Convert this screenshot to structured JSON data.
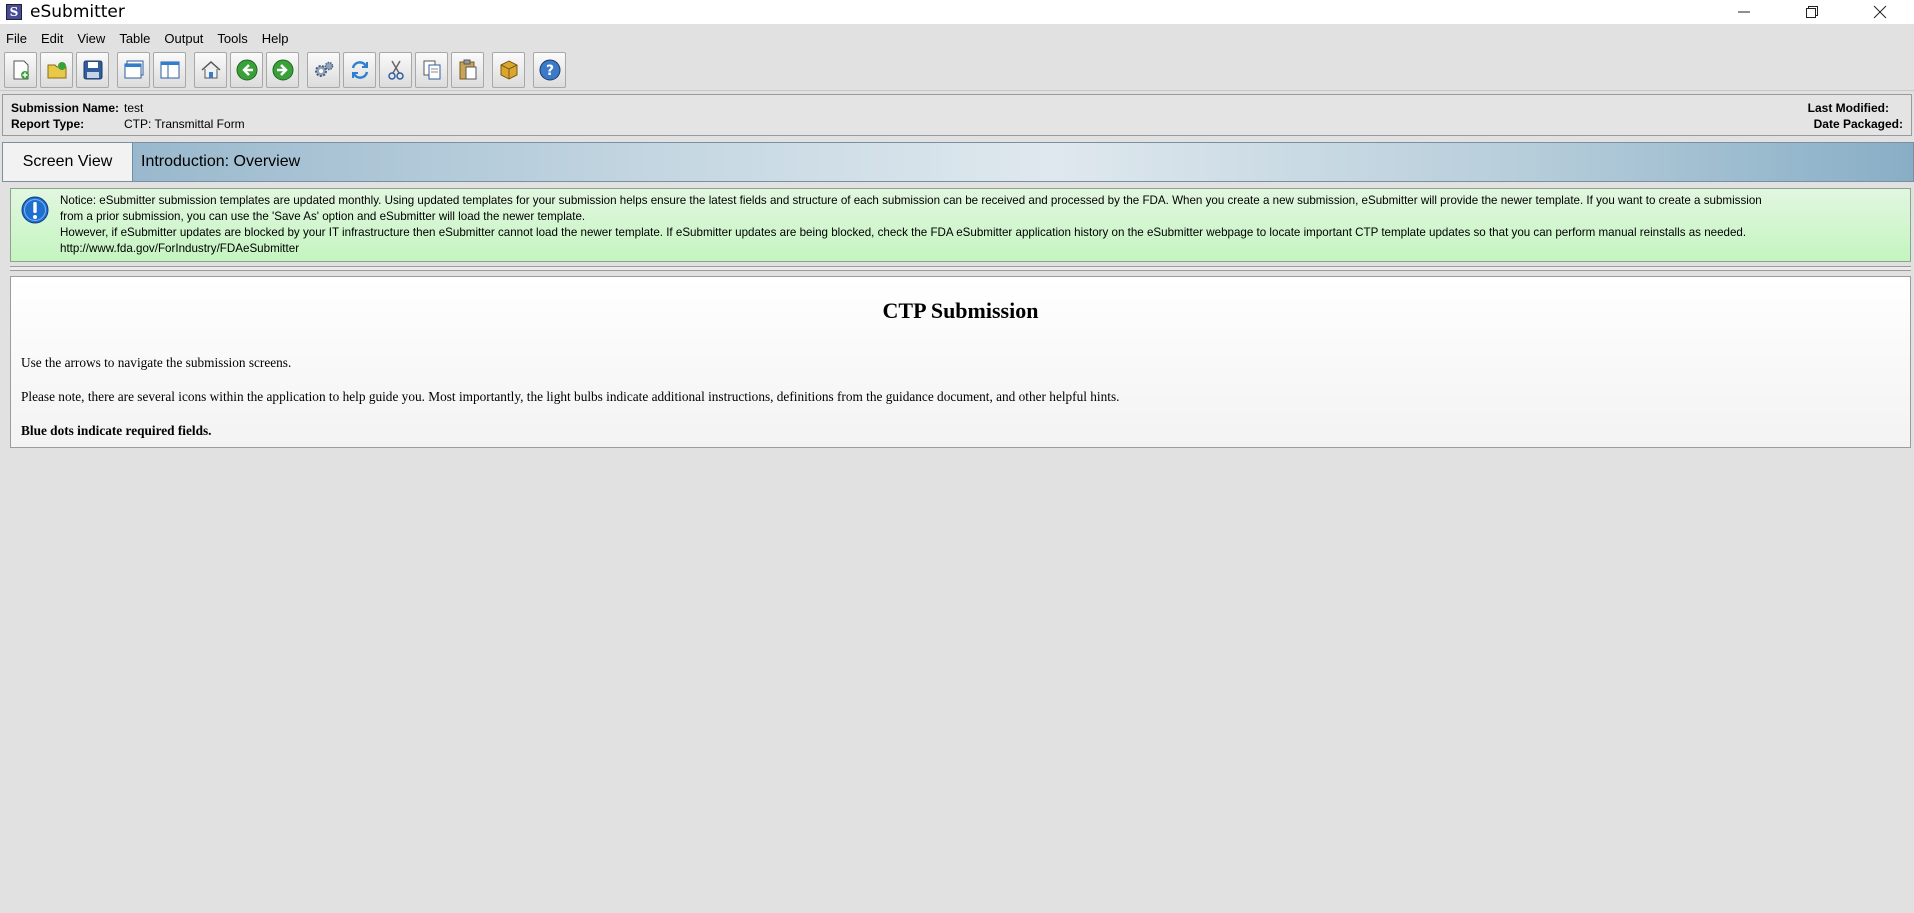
{
  "window": {
    "title": "eSubmitter",
    "app_icon_letter": "S"
  },
  "menu": [
    "File",
    "Edit",
    "View",
    "Table",
    "Output",
    "Tools",
    "Help"
  ],
  "toolbar": {
    "buttons": [
      {
        "name": "new-submission",
        "icon": "new-document-icon"
      },
      {
        "name": "open-submission",
        "icon": "open-folder-icon"
      },
      {
        "name": "save-submission",
        "icon": "save-disk-icon"
      },
      {
        "name": "window-view",
        "icon": "window-icon"
      },
      {
        "name": "split-view",
        "icon": "split-pane-icon"
      },
      {
        "name": "home",
        "icon": "home-icon"
      },
      {
        "name": "back",
        "icon": "arrow-left-icon"
      },
      {
        "name": "forward",
        "icon": "arrow-right-icon"
      },
      {
        "name": "settings",
        "icon": "gears-icon"
      },
      {
        "name": "refresh",
        "icon": "refresh-icon"
      },
      {
        "name": "cut",
        "icon": "scissors-icon"
      },
      {
        "name": "copy",
        "icon": "copy-icon"
      },
      {
        "name": "paste",
        "icon": "paste-icon"
      },
      {
        "name": "package",
        "icon": "package-icon"
      },
      {
        "name": "help",
        "icon": "help-icon"
      }
    ]
  },
  "submission": {
    "name_label": "Submission Name:",
    "name_value": "test",
    "type_label": "Report Type:",
    "type_value": "CTP: Transmittal Form",
    "last_modified_label": "Last Modified:",
    "date_packaged_label": "Date Packaged:"
  },
  "banner": {
    "tab_label": "Screen View",
    "title": "Introduction: Overview"
  },
  "notice": {
    "line1": "Notice: eSubmitter submission templates are updated monthly.  Using updated templates for your submission helps ensure the latest fields and structure of each submission can be received and processed by the FDA.  When you create a new submission, eSubmitter will provide the newer template. If you want to create a submission",
    "line2": "from a prior submission, you can use the 'Save As' option and eSubmitter will load the newer template.",
    "line3": "However, if eSubmitter updates are blocked by your IT infrastructure then eSubmitter cannot load the newer template. If eSubmitter updates are being blocked, check the FDA eSubmitter application history on the eSubmitter webpage to locate important CTP template updates so that you can perform manual reinstalls as needed.",
    "link": "http://www.fda.gov/ForIndustry/FDAeSubmitter"
  },
  "content": {
    "heading": "CTP Submission",
    "para1": "Use the arrows to navigate the submission screens.",
    "para2": "Please note, there are several icons within the application to help guide you. Most importantly, the light bulbs indicate additional instructions, definitions from the guidance document, and other helpful hints.",
    "para3": "Blue dots indicate required fields."
  }
}
